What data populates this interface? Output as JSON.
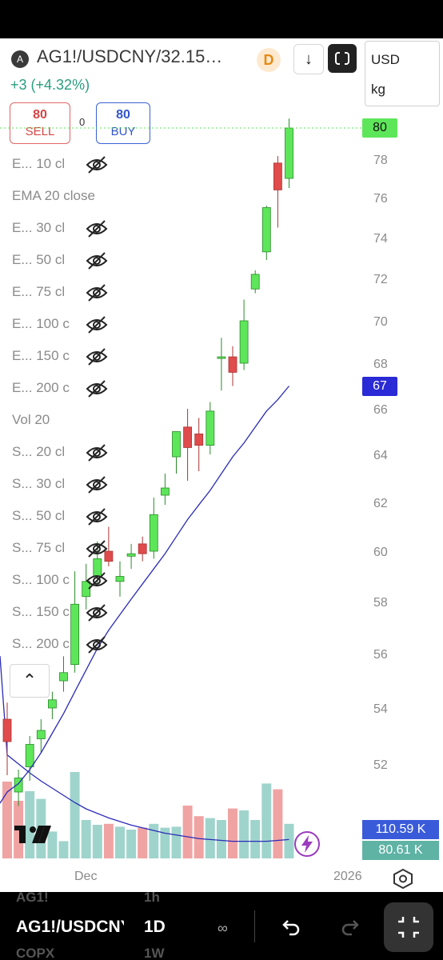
{
  "header": {
    "badge": "A",
    "symbol": "AG1!/USDCNY/32.15…",
    "change": "+3 (+4.32%)",
    "d_badge": "D",
    "down_icon": "arrow-down-icon",
    "unit_currency": "USD",
    "unit_weight": "kg"
  },
  "order": {
    "sell_price": "80",
    "sell_label": "SELL",
    "spread": "0",
    "buy_price": "80",
    "buy_label": "BUY"
  },
  "indicators": [
    {
      "label": "E... 10 cl",
      "hidden": true
    },
    {
      "label": "EMA 20 close",
      "hidden": false
    },
    {
      "label": "E... 30 cl",
      "hidden": true
    },
    {
      "label": "E... 50 cl",
      "hidden": true
    },
    {
      "label": "E... 75 cl",
      "hidden": true
    },
    {
      "label": "E... 100 c",
      "hidden": true
    },
    {
      "label": "E... 150 c",
      "hidden": true
    },
    {
      "label": "E... 200 c",
      "hidden": true
    },
    {
      "label": "Vol 20",
      "hidden": false
    },
    {
      "label": "S... 20 cl",
      "hidden": true
    },
    {
      "label": "S... 30 cl",
      "hidden": true
    },
    {
      "label": "S... 50 cl",
      "hidden": true
    },
    {
      "label": "S... 75 cl",
      "hidden": true
    },
    {
      "label": "S... 100 c",
      "hidden": true
    },
    {
      "label": "S... 150 c",
      "hidden": true
    },
    {
      "label": "S... 200 c",
      "hidden": true
    }
  ],
  "price_tags": {
    "last": "80",
    "ema": "67",
    "volume": "110.59 K",
    "volume_ma": "80.61 K"
  },
  "colors": {
    "up": "#5ee65a",
    "down": "#e04b4b",
    "ema": "#2b2bb8",
    "vol_up": "#9fd4cc",
    "vol_down": "#f0a3a3",
    "last_tag": "#5ee65a",
    "ema_tag": "#2a2ad6",
    "vol_tag": "#3a5bd9",
    "volma_tag": "#5fb3a5"
  },
  "x_axis": {
    "labels": [
      "Dec",
      "2026"
    ]
  },
  "bottom_bar": {
    "faded_top_symbol": "AG1!",
    "faded_top_interval": "1h",
    "symbol": "AG1!/USDCNY",
    "interval": "1D",
    "faded_bottom_symbol": "COPX",
    "faded_bottom_interval": "1W"
  },
  "chart_data": {
    "type": "candlestick",
    "y_ticks": [
      52,
      54,
      56,
      58,
      60,
      62,
      64,
      66,
      68,
      70,
      72,
      74,
      76,
      78,
      80
    ],
    "x_labels": [
      "Dec",
      "2026"
    ],
    "candles": [
      {
        "o": 53.6,
        "h": 54.2,
        "l": 51.6,
        "c": 52.8
      },
      {
        "o": 51.0,
        "h": 51.8,
        "l": 50.5,
        "c": 51.5
      },
      {
        "o": 51.9,
        "h": 53.0,
        "l": 51.4,
        "c": 52.7
      },
      {
        "o": 52.9,
        "h": 53.6,
        "l": 52.4,
        "c": 53.2
      },
      {
        "o": 54.0,
        "h": 54.6,
        "l": 53.6,
        "c": 54.3
      },
      {
        "o": 55.0,
        "h": 55.9,
        "l": 54.6,
        "c": 55.3
      },
      {
        "o": 55.6,
        "h": 59.2,
        "l": 55.3,
        "c": 57.9
      },
      {
        "o": 58.2,
        "h": 59.5,
        "l": 57.7,
        "c": 58.8
      },
      {
        "o": 59.0,
        "h": 60.4,
        "l": 58.7,
        "c": 59.7
      },
      {
        "o": 60.0,
        "h": 61.0,
        "l": 59.4,
        "c": 59.6
      },
      {
        "o": 58.8,
        "h": 59.6,
        "l": 58.2,
        "c": 59.0
      },
      {
        "o": 59.8,
        "h": 60.3,
        "l": 59.3,
        "c": 59.9
      },
      {
        "o": 60.3,
        "h": 60.6,
        "l": 59.6,
        "c": 59.9
      },
      {
        "o": 60.0,
        "h": 62.2,
        "l": 59.7,
        "c": 61.5
      },
      {
        "o": 62.3,
        "h": 63.2,
        "l": 61.9,
        "c": 62.6
      },
      {
        "o": 63.9,
        "h": 64.9,
        "l": 63.2,
        "c": 65.0
      },
      {
        "o": 65.2,
        "h": 66.0,
        "l": 62.9,
        "c": 64.3
      },
      {
        "o": 64.9,
        "h": 65.6,
        "l": 63.3,
        "c": 64.4
      },
      {
        "o": 64.4,
        "h": 66.3,
        "l": 64.0,
        "c": 65.9
      },
      {
        "o": 68.3,
        "h": 69.2,
        "l": 66.8,
        "c": 68.3
      },
      {
        "o": 68.3,
        "h": 68.8,
        "l": 67.0,
        "c": 67.6
      },
      {
        "o": 68.0,
        "h": 71.0,
        "l": 67.7,
        "c": 70.0
      },
      {
        "o": 71.5,
        "h": 72.4,
        "l": 71.3,
        "c": 72.2
      },
      {
        "o": 73.3,
        "h": 75.6,
        "l": 72.9,
        "c": 75.5
      },
      {
        "o": 77.8,
        "h": 78.2,
        "l": 74.5,
        "c": 76.4
      },
      {
        "o": 77.0,
        "h": 80.6,
        "l": 76.5,
        "c": 80.0
      }
    ],
    "ema_20": [
      51.0,
      51.3,
      51.8,
      52.4,
      53.1,
      53.8,
      54.6,
      55.4,
      56.2,
      56.9,
      57.5,
      58.1,
      58.7,
      59.3,
      59.9,
      60.6,
      61.3,
      61.9,
      62.5,
      63.2,
      63.9,
      64.5,
      65.2,
      65.9,
      66.4,
      67.0
    ],
    "volume": [
      {
        "v": 0.8,
        "up": false
      },
      {
        "v": 0.6,
        "up": false
      },
      {
        "v": 0.7,
        "up": true
      },
      {
        "v": 0.62,
        "up": true
      },
      {
        "v": 0.28,
        "up": true
      },
      {
        "v": 0.18,
        "up": true
      },
      {
        "v": 0.9,
        "up": true
      },
      {
        "v": 0.4,
        "up": true
      },
      {
        "v": 0.35,
        "up": true
      },
      {
        "v": 0.36,
        "up": false
      },
      {
        "v": 0.33,
        "up": true
      },
      {
        "v": 0.3,
        "up": true
      },
      {
        "v": 0.32,
        "up": false
      },
      {
        "v": 0.36,
        "up": true
      },
      {
        "v": 0.32,
        "up": true
      },
      {
        "v": 0.33,
        "up": true
      },
      {
        "v": 0.55,
        "up": false
      },
      {
        "v": 0.44,
        "up": false
      },
      {
        "v": 0.42,
        "up": true
      },
      {
        "v": 0.4,
        "up": true
      },
      {
        "v": 0.52,
        "up": false
      },
      {
        "v": 0.5,
        "up": true
      },
      {
        "v": 0.4,
        "up": true
      },
      {
        "v": 0.78,
        "up": true
      },
      {
        "v": 0.72,
        "up": false
      },
      {
        "v": 0.36,
        "up": true
      }
    ],
    "volume_ma": [
      1.15,
      1.05,
      0.95,
      0.86,
      0.78,
      0.7,
      0.62,
      0.55,
      0.5,
      0.45,
      0.41,
      0.37,
      0.34,
      0.31,
      0.28,
      0.26,
      0.24,
      0.22,
      0.21,
      0.2,
      0.19,
      0.19,
      0.19,
      0.19,
      0.2,
      0.21
    ]
  }
}
